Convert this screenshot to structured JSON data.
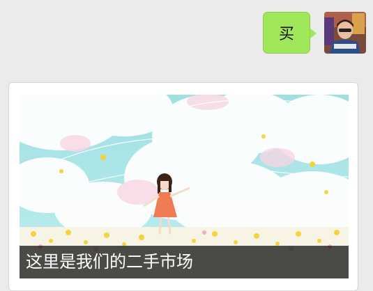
{
  "chat": {
    "outgoing_message": {
      "text": "买",
      "bubble_color": "#a0e75a"
    },
    "shared_card": {
      "caption": "这里是我们的二手市场"
    }
  },
  "colors": {
    "background": "#ebebeb",
    "card_background": "#ffffff"
  }
}
